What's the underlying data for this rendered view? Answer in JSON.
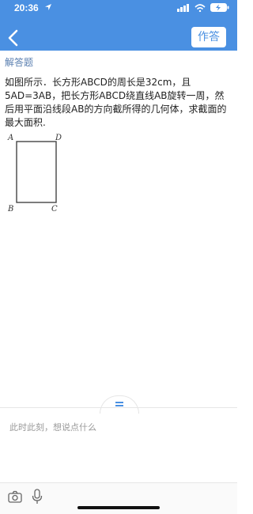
{
  "status_bar": {
    "time": "20:36"
  },
  "header": {
    "action_label": "作答"
  },
  "section": {
    "title": "解答题"
  },
  "question": {
    "text": "如图所示．长方形ABCD的周长是32cm，且5AD=3AB，把长方形ABCD绕直线AB旋转一周，然后用平面沿线段AB的方向截所得的几何体，求截面的最大面积."
  },
  "figure": {
    "labels": {
      "A": "A",
      "B": "B",
      "C": "C",
      "D": "D"
    }
  },
  "comment": {
    "placeholder": "此时此刻，想说点什么"
  },
  "colors": {
    "accent": "#4a90e2",
    "section_text": "#5a7fb0"
  }
}
